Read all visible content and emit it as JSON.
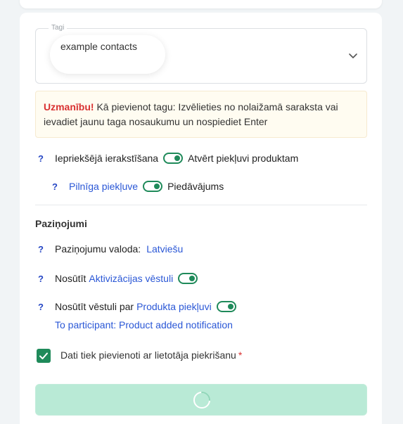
{
  "tags": {
    "legend": "Tagi",
    "chip": "example contacts"
  },
  "alert": {
    "strong": "Uzmanību!",
    "text": "Kā pievienot tagu: Izvēlieties no nolaižamā saraksta vai ievadiet jaunu taga nosaukumu un nospiediet Enter"
  },
  "help_mark": "?",
  "options": {
    "preorder_label": "Iepriekšējā ierakstīšana",
    "open_access_label": "Atvērt piekļuvi produktam",
    "full_access_link": "Pilnīga piekļuve",
    "offer_label": "Piedāvājums"
  },
  "notifications": {
    "title": "Paziņojumi",
    "language_label": "Paziņojumu valoda:",
    "language_value": "Latviešu",
    "send_label": "Nosūtīt",
    "activation_link": "Aktivizācijas vēstuli",
    "send_letter_label": "Nosūtīt vēstuli par",
    "product_access_link": "Produkta piekļuvi",
    "participant_link": "To participant: Product added notification"
  },
  "consent": {
    "label": "Dati tiek pievienoti ar lietotāja piekrišanu",
    "required_mark": "*"
  },
  "colors": {
    "accent_green": "#1f8a5a",
    "link_blue": "#2a57d6",
    "warning_red": "#d93232",
    "submit_bg": "#b9ead6"
  },
  "icons": {
    "dropdown": "chevron-down-icon",
    "checkbox": "check-icon",
    "loading": "spinner-icon"
  }
}
